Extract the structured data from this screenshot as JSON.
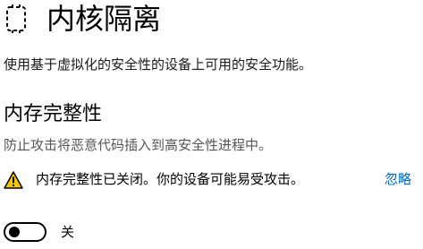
{
  "page": {
    "icon": "core-isolation-chip-icon",
    "title": "内核隔离",
    "description": "使用基于虚拟化的安全性的设备上可用的安全功能。"
  },
  "memory_integrity": {
    "heading": "内存完整性",
    "description": "防止攻击将恶意代码插入到高安全性进程中。",
    "warning_icon": "warning-triangle-icon",
    "warning_color": "#f7c500",
    "warning_text": "内存完整性已关闭。你的设备可能易受攻击。",
    "ignore_label": "忽略",
    "toggle_state": "off",
    "toggle_label": "关"
  }
}
